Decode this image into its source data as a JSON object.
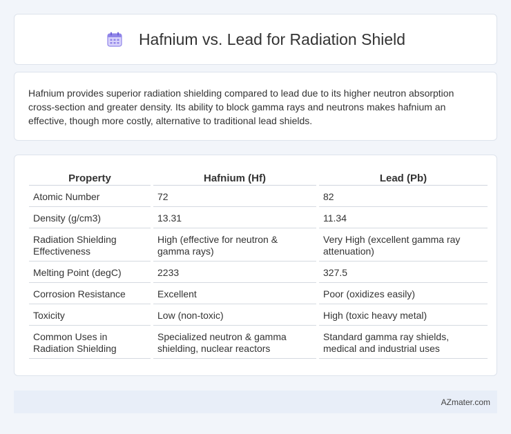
{
  "header": {
    "title": "Hafnium vs. Lead for Radiation Shield",
    "icon": "calendar-icon",
    "icon_color": "#7b6ee0"
  },
  "summary": {
    "text": "Hafnium provides superior radiation shielding compared to lead due to its higher neutron absorption cross-section and greater density. Its ability to block gamma rays and neutrons makes hafnium an effective, though more costly, alternative to traditional lead shields."
  },
  "table": {
    "headers": [
      "Property",
      "Hafnium (Hf)",
      "Lead (Pb)"
    ],
    "rows": [
      [
        "Atomic Number",
        "72",
        "82"
      ],
      [
        "Density (g/cm3)",
        "13.31",
        "11.34"
      ],
      [
        "Radiation Shielding Effectiveness",
        "High (effective for neutron & gamma rays)",
        "Very High (excellent gamma ray attenuation)"
      ],
      [
        "Melting Point (degC)",
        "2233",
        "327.5"
      ],
      [
        "Corrosion Resistance",
        "Excellent",
        "Poor (oxidizes easily)"
      ],
      [
        "Toxicity",
        "Low (non-toxic)",
        "High (toxic heavy metal)"
      ],
      [
        "Common Uses in Radiation Shielding",
        "Specialized neutron & gamma shielding, nuclear reactors",
        "Standard gamma ray shields, medical and industrial uses"
      ]
    ]
  },
  "footer": {
    "text": "AZmater.com"
  }
}
